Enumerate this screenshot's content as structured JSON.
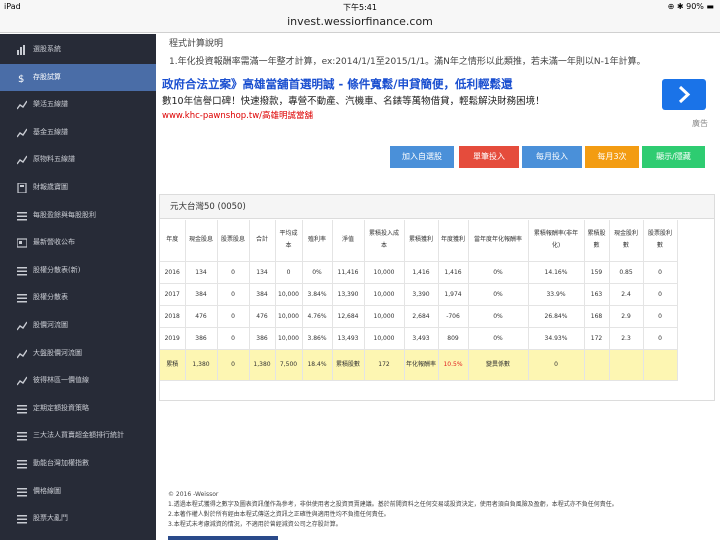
{
  "status_bar": {
    "device": "iPad",
    "time": "下午5:41",
    "battery": "90%"
  },
  "url": "invest.wessiorfinance.com",
  "sidebar": {
    "items": [
      {
        "label": "選股系統",
        "icon": "bar-chart-icon"
      },
      {
        "label": "存股試算",
        "icon": "dollar-icon"
      },
      {
        "label": "樂活五線譜",
        "icon": "line-chart-icon"
      },
      {
        "label": "基金五線譜",
        "icon": "line-chart-icon"
      },
      {
        "label": "原物料五線譜",
        "icon": "line-chart-icon"
      },
      {
        "label": "財報歲寶圖",
        "icon": "calculator-icon"
      },
      {
        "label": "每股盈餘與每股股利",
        "icon": "list-icon"
      },
      {
        "label": "最新營收公布",
        "icon": "newspaper-icon"
      },
      {
        "label": "股權分散表(新)",
        "icon": "list-icon"
      },
      {
        "label": "股權分散表",
        "icon": "list-icon"
      },
      {
        "label": "股價河流圖",
        "icon": "line-chart-icon"
      },
      {
        "label": "大盤股價河流圖",
        "icon": "line-chart-icon"
      },
      {
        "label": "彼得林區一價值線",
        "icon": "line-chart-icon"
      },
      {
        "label": "定期定額投資策略",
        "icon": "list-icon"
      },
      {
        "label": "三大法人買賣超金額排行統計",
        "icon": "list-icon"
      },
      {
        "label": "動能台灣加權指數",
        "icon": "list-icon"
      },
      {
        "label": "價格線圖",
        "icon": "list-icon"
      },
      {
        "label": "股票大亂鬥",
        "icon": "list-icon"
      }
    ],
    "active_index": 1
  },
  "explain": {
    "title": "程式計算說明",
    "text": "1.年化投資報酬率需滿一年整才計算，ex:2014/1/1至2015/1/1。滿N年之情形以此類推，若未滿一年則以N-1年計算。"
  },
  "ad": {
    "title": "政府合法立案》高雄當舖首選明誠 - 條件寬鬆/申貸簡便，低利輕鬆還",
    "desc": "數10年信譽口碑！快速撥款，專營不動產、汽機車、名錶等萬物借貸，輕鬆解決財務困境！",
    "url": "www.khc-pawnshop.tw/高雄明誠當舖",
    "label": "廣告"
  },
  "buttons": [
    {
      "label": "加入自選股",
      "color": "#4a90d9"
    },
    {
      "label": "單筆投入",
      "color": "#e54c3c"
    },
    {
      "label": "每月投入",
      "color": "#4a90d9"
    },
    {
      "label": "每月3次",
      "color": "#f39c12"
    },
    {
      "label": "顯示/隱藏",
      "color": "#2ecc71"
    }
  ],
  "panel_title": "元大台灣50 (0050)",
  "table": {
    "headers": [
      "年度",
      "現金股息",
      "股票股息",
      "合計",
      "平均成本",
      "殖利率",
      "淨值",
      "累積投入成本",
      "累積獲利",
      "年度獲利",
      "當年度年化報酬率",
      "累積報酬率(非年化)",
      "累積股數",
      "現金股利數",
      "股票股利數"
    ],
    "rows": [
      [
        "2016",
        "134",
        "0",
        "134",
        "0",
        "0%",
        "11,416",
        "10,000",
        "1,416",
        "1,416",
        "0%",
        "14.16%",
        "159",
        "0.85",
        "0"
      ],
      [
        "2017",
        "384",
        "0",
        "384",
        "10,000",
        "3.84%",
        "13,390",
        "10,000",
        "3,390",
        "1,974",
        "0%",
        "33.9%",
        "163",
        "2.4",
        "0"
      ],
      [
        "2018",
        "476",
        "0",
        "476",
        "10,000",
        "4.76%",
        "12,684",
        "10,000",
        "2,684",
        "-706",
        "0%",
        "26.84%",
        "168",
        "2.9",
        "0"
      ],
      [
        "2019",
        "386",
        "0",
        "386",
        "10,000",
        "3.86%",
        "13,493",
        "10,000",
        "3,493",
        "809",
        "0%",
        "34.93%",
        "172",
        "2.3",
        "0"
      ]
    ],
    "summary": [
      "累積",
      "1,380",
      "0",
      "1,380",
      "7,500",
      "18.4%",
      "累積股數",
      "172",
      "年化報酬率",
      "10.5%",
      "變異係數",
      "0",
      "",
      "",
      ""
    ]
  },
  "footer": [
    "© 2016 -Weissor",
    "1.透過本程式獲得之數字及圖表資訊僅作為參考，非供使用者之投資買賣建議。基於前開資料之任何交易或投資決定，使用者須自負風險及盈虧，本程式亦不負任何責任。",
    "2.本著作權人對於所有經由本程式傳送之資訊之正確性與適用性均不負擔任何責任。",
    "3.本程式未考慮減資的情況，不適用於曾經減資公司之存股計算。"
  ]
}
